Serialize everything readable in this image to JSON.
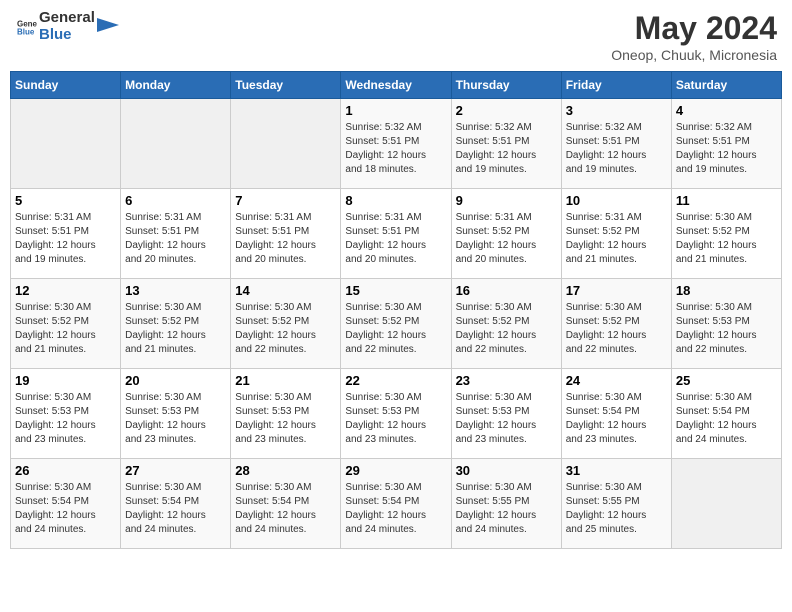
{
  "header": {
    "logo_general": "General",
    "logo_blue": "Blue",
    "month_year": "May 2024",
    "location": "Oneop, Chuuk, Micronesia"
  },
  "weekdays": [
    "Sunday",
    "Monday",
    "Tuesday",
    "Wednesday",
    "Thursday",
    "Friday",
    "Saturday"
  ],
  "weeks": [
    [
      {
        "day": "",
        "info": ""
      },
      {
        "day": "",
        "info": ""
      },
      {
        "day": "",
        "info": ""
      },
      {
        "day": "1",
        "info": "Sunrise: 5:32 AM\nSunset: 5:51 PM\nDaylight: 12 hours\nand 18 minutes."
      },
      {
        "day": "2",
        "info": "Sunrise: 5:32 AM\nSunset: 5:51 PM\nDaylight: 12 hours\nand 19 minutes."
      },
      {
        "day": "3",
        "info": "Sunrise: 5:32 AM\nSunset: 5:51 PM\nDaylight: 12 hours\nand 19 minutes."
      },
      {
        "day": "4",
        "info": "Sunrise: 5:32 AM\nSunset: 5:51 PM\nDaylight: 12 hours\nand 19 minutes."
      }
    ],
    [
      {
        "day": "5",
        "info": "Sunrise: 5:31 AM\nSunset: 5:51 PM\nDaylight: 12 hours\nand 19 minutes."
      },
      {
        "day": "6",
        "info": "Sunrise: 5:31 AM\nSunset: 5:51 PM\nDaylight: 12 hours\nand 20 minutes."
      },
      {
        "day": "7",
        "info": "Sunrise: 5:31 AM\nSunset: 5:51 PM\nDaylight: 12 hours\nand 20 minutes."
      },
      {
        "day": "8",
        "info": "Sunrise: 5:31 AM\nSunset: 5:51 PM\nDaylight: 12 hours\nand 20 minutes."
      },
      {
        "day": "9",
        "info": "Sunrise: 5:31 AM\nSunset: 5:52 PM\nDaylight: 12 hours\nand 20 minutes."
      },
      {
        "day": "10",
        "info": "Sunrise: 5:31 AM\nSunset: 5:52 PM\nDaylight: 12 hours\nand 21 minutes."
      },
      {
        "day": "11",
        "info": "Sunrise: 5:30 AM\nSunset: 5:52 PM\nDaylight: 12 hours\nand 21 minutes."
      }
    ],
    [
      {
        "day": "12",
        "info": "Sunrise: 5:30 AM\nSunset: 5:52 PM\nDaylight: 12 hours\nand 21 minutes."
      },
      {
        "day": "13",
        "info": "Sunrise: 5:30 AM\nSunset: 5:52 PM\nDaylight: 12 hours\nand 21 minutes."
      },
      {
        "day": "14",
        "info": "Sunrise: 5:30 AM\nSunset: 5:52 PM\nDaylight: 12 hours\nand 22 minutes."
      },
      {
        "day": "15",
        "info": "Sunrise: 5:30 AM\nSunset: 5:52 PM\nDaylight: 12 hours\nand 22 minutes."
      },
      {
        "day": "16",
        "info": "Sunrise: 5:30 AM\nSunset: 5:52 PM\nDaylight: 12 hours\nand 22 minutes."
      },
      {
        "day": "17",
        "info": "Sunrise: 5:30 AM\nSunset: 5:52 PM\nDaylight: 12 hours\nand 22 minutes."
      },
      {
        "day": "18",
        "info": "Sunrise: 5:30 AM\nSunset: 5:53 PM\nDaylight: 12 hours\nand 22 minutes."
      }
    ],
    [
      {
        "day": "19",
        "info": "Sunrise: 5:30 AM\nSunset: 5:53 PM\nDaylight: 12 hours\nand 23 minutes."
      },
      {
        "day": "20",
        "info": "Sunrise: 5:30 AM\nSunset: 5:53 PM\nDaylight: 12 hours\nand 23 minutes."
      },
      {
        "day": "21",
        "info": "Sunrise: 5:30 AM\nSunset: 5:53 PM\nDaylight: 12 hours\nand 23 minutes."
      },
      {
        "day": "22",
        "info": "Sunrise: 5:30 AM\nSunset: 5:53 PM\nDaylight: 12 hours\nand 23 minutes."
      },
      {
        "day": "23",
        "info": "Sunrise: 5:30 AM\nSunset: 5:53 PM\nDaylight: 12 hours\nand 23 minutes."
      },
      {
        "day": "24",
        "info": "Sunrise: 5:30 AM\nSunset: 5:54 PM\nDaylight: 12 hours\nand 23 minutes."
      },
      {
        "day": "25",
        "info": "Sunrise: 5:30 AM\nSunset: 5:54 PM\nDaylight: 12 hours\nand 24 minutes."
      }
    ],
    [
      {
        "day": "26",
        "info": "Sunrise: 5:30 AM\nSunset: 5:54 PM\nDaylight: 12 hours\nand 24 minutes."
      },
      {
        "day": "27",
        "info": "Sunrise: 5:30 AM\nSunset: 5:54 PM\nDaylight: 12 hours\nand 24 minutes."
      },
      {
        "day": "28",
        "info": "Sunrise: 5:30 AM\nSunset: 5:54 PM\nDaylight: 12 hours\nand 24 minutes."
      },
      {
        "day": "29",
        "info": "Sunrise: 5:30 AM\nSunset: 5:54 PM\nDaylight: 12 hours\nand 24 minutes."
      },
      {
        "day": "30",
        "info": "Sunrise: 5:30 AM\nSunset: 5:55 PM\nDaylight: 12 hours\nand 24 minutes."
      },
      {
        "day": "31",
        "info": "Sunrise: 5:30 AM\nSunset: 5:55 PM\nDaylight: 12 hours\nand 25 minutes."
      },
      {
        "day": "",
        "info": ""
      }
    ]
  ]
}
